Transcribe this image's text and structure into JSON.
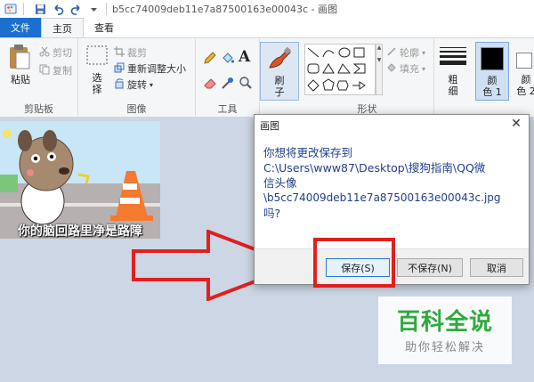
{
  "window": {
    "title": "b5cc74009deb11e7a87500163e00043c - 画图"
  },
  "tabs": [
    {
      "label": "文件"
    },
    {
      "label": "主页"
    },
    {
      "label": "查看"
    }
  ],
  "ribbon": {
    "clipboard": {
      "paste": "粘贴",
      "cut": "剪切",
      "copy": "复制",
      "group": "剪贴板"
    },
    "image": {
      "select_line1": "选",
      "select_line2": "择",
      "crop": "裁剪",
      "resize": "重新调整大小",
      "rotate": "旋转",
      "group": "图像"
    },
    "tools": {
      "group": "工具"
    },
    "brushes": {
      "line1": "刷",
      "line2": "子"
    },
    "shapes": {
      "outline": "轮廓",
      "fill": "填充",
      "group": "形状"
    },
    "size": {
      "line1": "粗",
      "line2": "细"
    },
    "colors": {
      "color1": "颜\n色 1",
      "color1_a": "颜",
      "color1_b": "色 1",
      "color2_a": "颜",
      "color2_b": "色 2"
    }
  },
  "canvas": {
    "caption": "你的脑回路里净是路障"
  },
  "dialog": {
    "title": "画图",
    "message_line1": "你想将更改保存到",
    "message_line2": "C:\\Users\\www87\\Desktop\\搜狗指南\\QQ微",
    "message_line3": "信头像",
    "message_line4": "\\b5cc74009deb11e7a87500163e00043c.jpg",
    "message_line5": "吗?",
    "save": "保存(S)",
    "dont_save": "不保存(N)",
    "cancel": "取消"
  },
  "watermark": {
    "main": "百科全说",
    "sub": "助你轻松解决"
  },
  "colors": {
    "accent": "#1a6fcf",
    "highlight": "#e02020",
    "watermark_green": "#2faa3e"
  }
}
